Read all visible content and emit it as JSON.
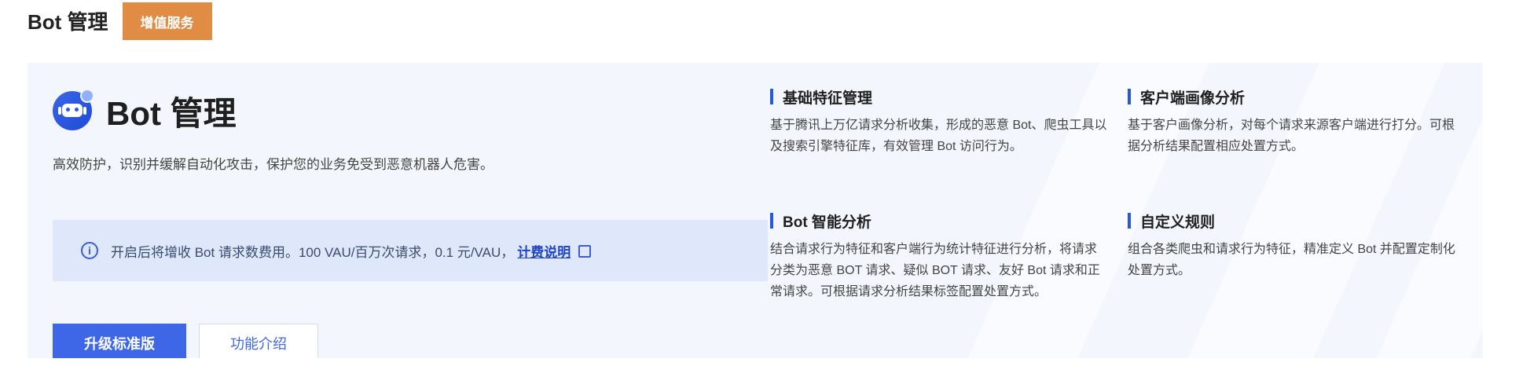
{
  "header": {
    "title": "Bot 管理",
    "badge": "增值服务"
  },
  "card": {
    "product_title": "Bot 管理",
    "description": "高效防护，识别并缓解自动化攻击，保护您的业务免受到恶意机器人危害。",
    "notice": {
      "text": "开启后将增收 Bot 请求数费用。100 VAU/百万次请求，0.1 元/VAU，",
      "link_label": "计费说明",
      "icon": "info-icon"
    },
    "buttons": {
      "primary": "升级标准版",
      "secondary": "功能介绍"
    }
  },
  "features": [
    {
      "title": "基础特征管理",
      "description": "基于腾讯上万亿请求分析收集，形成的恶意 Bot、爬虫工具以及搜索引擎特征库，有效管理 Bot 访问行为。"
    },
    {
      "title": "客户端画像分析",
      "description": "基于客户画像分析，对每个请求来源客户端进行打分。可根据分析结果配置相应处置方式。"
    },
    {
      "title": "Bot 智能分析",
      "description": "结合请求行为特征和客户端行为统计特征进行分析，将请求分类为恶意 BOT 请求、疑似 BOT 请求、友好 Bot 请求和正常请求。可根据请求分析结果标签配置处置方式。"
    },
    {
      "title": "自定义规则",
      "description": "组合各类爬虫和请求行为特征，精准定义 Bot 并配置定制化处置方式。"
    }
  ],
  "colors": {
    "accent": "#3e67e8",
    "badge": "#e08c45",
    "card_bg": "#f3f6fd"
  }
}
